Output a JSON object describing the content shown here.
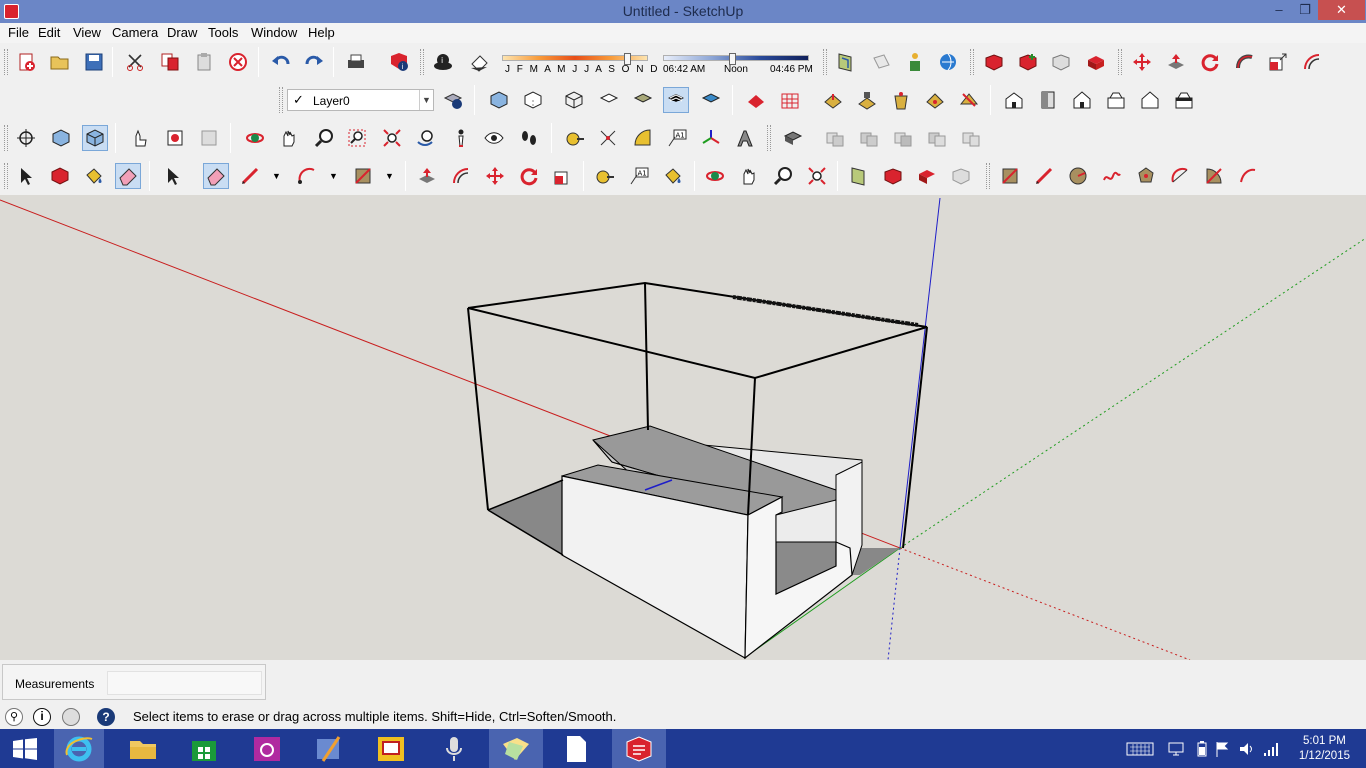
{
  "window": {
    "title": "Untitled - SketchUp",
    "minimize": "‒",
    "restore": "❐",
    "close": "✕"
  },
  "menu": [
    "File",
    "Edit",
    "View",
    "Camera",
    "Draw",
    "Tools",
    "Window",
    "Help"
  ],
  "shadow": {
    "months": [
      "J",
      "F",
      "M",
      "A",
      "M",
      "J",
      "J",
      "A",
      "S",
      "O",
      "N",
      "D"
    ],
    "time_start": "06:42 AM",
    "time_mid": "Noon",
    "time_end": "04:46 PM"
  },
  "layer": {
    "name": "Layer0",
    "checked": true
  },
  "measurements": {
    "label": "Measurements",
    "value": ""
  },
  "status": {
    "text": "Select items to erase or drag across multiple items. Shift=Hide, Ctrl=Soften/Smooth."
  },
  "clock": {
    "time": "5:01 PM",
    "date": "1/12/2015"
  },
  "colors": {
    "accent": "#d9232e",
    "axis_red": "#c81e1e",
    "axis_green": "#1e9c1e",
    "axis_blue": "#1e1ec8",
    "taskbar": "#1f3a93",
    "titlebar": "#6b86c6"
  }
}
